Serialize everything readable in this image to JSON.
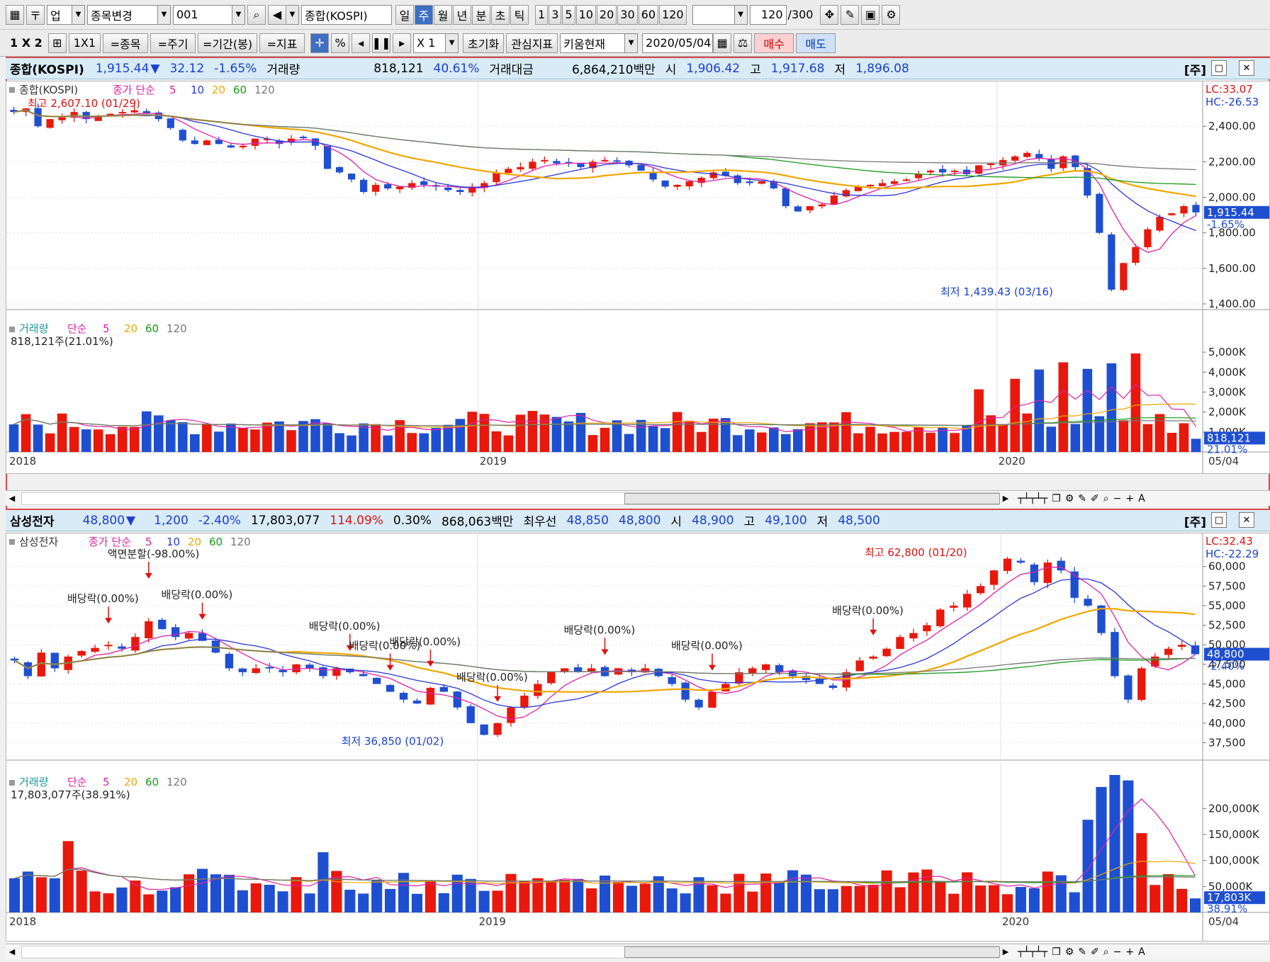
{
  "toolbar1": {
    "market": "업",
    "change_label": "종목변경",
    "code": "001",
    "name": "종합(KOSPI)",
    "periods": [
      "일",
      "주",
      "월",
      "년",
      "분",
      "초",
      "틱"
    ],
    "active_period": "주",
    "minutes": [
      "1",
      "3",
      "5",
      "10",
      "20",
      "30",
      "60",
      "120"
    ],
    "count": "120",
    "count_max": "/300"
  },
  "toolbar2": {
    "layout": "1 X 2",
    "layout2": "1X1",
    "buttons": [
      "=종목",
      "=주기",
      "=기간(봉)",
      "=지표"
    ],
    "pct": "%",
    "zoom": "X 1",
    "reset": "초기화",
    "interest": "관심지표",
    "kiwoom": "키움현재",
    "date": "2020/05/04",
    "buy": "매수",
    "sell": "매도"
  },
  "panels": [
    {
      "info": {
        "name": "종합(KOSPI)",
        "price": "1,915.44",
        "arrow": "▼",
        "change": "32.12",
        "pct": "-1.65%",
        "vol_label": "거래량",
        "volume": "818,121",
        "vol_pct": "40.61%",
        "amount_label": "거래대금",
        "amount": "6,864,210백만",
        "open_label": "시",
        "open": "1,906.42",
        "high_label": "고",
        "high": "1,917.68",
        "low_label": "저",
        "low": "1,896.08"
      },
      "price_legend": {
        "name": "종합(KOSPI)",
        "label": "종가 단순",
        "ma": [
          "5",
          "10",
          "20",
          "60",
          "120"
        ]
      },
      "lc": "LC:33.07",
      "hc": "HC:-26.53",
      "high_note": "최고 2,607.10 (01/29)",
      "low_note": "최저 1,439.43 (03/16)",
      "price_axis": [
        "2,400.00",
        "2,200.00",
        "2,000.00",
        "1,800.00",
        "1,600.00",
        "1,400.00"
      ],
      "current_label": "1,915.44",
      "current_pct": "-1.65%",
      "vol_legend": {
        "name": "거래량",
        "label": "단순",
        "ma": [
          "5",
          "20",
          "60",
          "120"
        ],
        "value": "818,121주(21.01%)"
      },
      "vol_axis": [
        "5,000K",
        "4,000K",
        "3,000K",
        "2,000K",
        "1,000K"
      ],
      "vol_current": "818,121",
      "vol_current_pct": "21.01%",
      "dates": [
        "2018",
        "2019",
        "2020"
      ],
      "date_end": "05/04",
      "annotations": []
    },
    {
      "info": {
        "name": "삼성전자",
        "price": "48,800",
        "arrow": "▼",
        "change": "1,200",
        "pct": "-2.40%",
        "volume": "17,803,077",
        "vol_pct": "114.09%",
        "turnover": "0.30%",
        "amount": "868,063백만",
        "best_label": "최우선",
        "best_ask": "48,850",
        "best_bid": "48,800",
        "open_label": "시",
        "open": "48,900",
        "high_label": "고",
        "high": "49,100",
        "low_label": "저",
        "low": "48,500"
      },
      "price_legend": {
        "name": "삼성전자",
        "label": "종가 단순",
        "ma": [
          "5",
          "10",
          "20",
          "60",
          "120"
        ]
      },
      "lc": "LC:32.43",
      "hc": "HC:-22.29",
      "high_note": "최고 62,800 (01/20)",
      "low_note": "최저 36,850 (01/02)",
      "price_axis": [
        "60,000",
        "57,500",
        "55,000",
        "52,500",
        "50,000",
        "47,500",
        "45,000",
        "42,500",
        "40,000",
        "37,500"
      ],
      "current_label": "48,800",
      "current_pct": "-2.40%",
      "vol_legend": {
        "name": "거래량",
        "label": "단순",
        "ma": [
          "5",
          "20",
          "60",
          "120"
        ],
        "value": "17,803,077주(38.91%)"
      },
      "vol_axis": [
        "200,000K",
        "150,000K",
        "100,000K",
        "50,000K"
      ],
      "vol_current": "17,803K",
      "vol_current_pct": "38.91%",
      "dates": [
        "2018",
        "2019",
        "2020"
      ],
      "date_end": "05/04",
      "annotations": [
        "배당락(0.00%)",
        "액면분할(-98.00%)",
        "배당락(0.00%)",
        "배당락(0.00%)",
        "배당락(0.00%)",
        "배당락(0.00%)",
        "배당락(0.00%)",
        "배당락(0.00%)",
        "배당락(0.00%)",
        "배당락(0.00%)"
      ]
    }
  ],
  "colors": {
    "up": "#e8180c",
    "down": "#1f4fd1",
    "ma5": "#e020a8",
    "ma10": "#2a36d8",
    "ma20": "#f2a600",
    "ma60": "#1a9a1a",
    "ma120": "#777777"
  },
  "chart_data": [
    {
      "type": "candlestick",
      "title": "종합(KOSPI)",
      "period": "weekly",
      "series": [
        {
          "name": "close",
          "values": [
            2480,
            2500,
            2400,
            2440,
            2450,
            2480,
            2440,
            2460,
            2470,
            2480,
            2490,
            2470,
            2440,
            2390,
            2320,
            2300,
            2320,
            2300,
            2280,
            2290,
            2330,
            2330,
            2300,
            2330,
            2340,
            2290,
            2160,
            2140,
            2100,
            2030,
            2070,
            2050,
            2060,
            2080,
            2070,
            2060,
            2040,
            2030,
            2060,
            2080,
            2140,
            2160,
            2170,
            2200,
            2210,
            2190,
            2190,
            2170,
            2200,
            2210,
            2200,
            2180,
            2150,
            2100,
            2060,
            2070,
            2090,
            2110,
            2140,
            2120,
            2080,
            2080,
            2090,
            2050,
            1950,
            1920,
            1950,
            1960,
            2010,
            2040,
            2060,
            2070,
            2080,
            2090,
            2100,
            2130,
            2150,
            2140,
            2150,
            2130,
            2180,
            2190,
            2210,
            2230,
            2250,
            2220,
            2160,
            2230,
            2170,
            2010,
            1800,
            1480,
            1630,
            1720,
            1820,
            1890,
            1910,
            1950,
            1915
          ]
        }
      ],
      "ylim": [
        1400,
        2620
      ],
      "high": "2,607.10 (01/29)",
      "low": "1,439.43 (03/16)"
    },
    {
      "type": "candlestick",
      "title": "삼성전자",
      "period": "weekly",
      "series": [
        {
          "name": "close",
          "values": [
            48000,
            46000,
            49000,
            47000,
            48500,
            49200,
            49600,
            50000,
            49500,
            51000,
            53000,
            52000,
            51000,
            51500,
            50500,
            49000,
            47000,
            46500,
            47000,
            47000,
            46500,
            47500,
            47000,
            46000,
            47000,
            46500,
            46000,
            45000,
            44000,
            43000,
            42500,
            44500,
            44000,
            42000,
            40000,
            38500,
            40000,
            42000,
            43500,
            45000,
            46500,
            47000,
            46500,
            47000,
            46000,
            47000,
            46500,
            47000,
            46000,
            45000,
            43000,
            42000,
            44000,
            45000,
            46500,
            47000,
            47500,
            46500,
            46000,
            45500,
            45000,
            44500,
            46500,
            48000,
            48500,
            49500,
            51000,
            51500,
            52500,
            54500,
            55000,
            56500,
            57500,
            59500,
            61000,
            60500,
            58000,
            60500,
            59500,
            56000,
            55000,
            51500,
            46000,
            43000,
            47000,
            48500,
            49500,
            50000,
            48800
          ]
        }
      ],
      "ylim": [
        36000,
        63500
      ],
      "high": "62,800 (01/20)",
      "low": "36,850 (01/02)"
    }
  ]
}
